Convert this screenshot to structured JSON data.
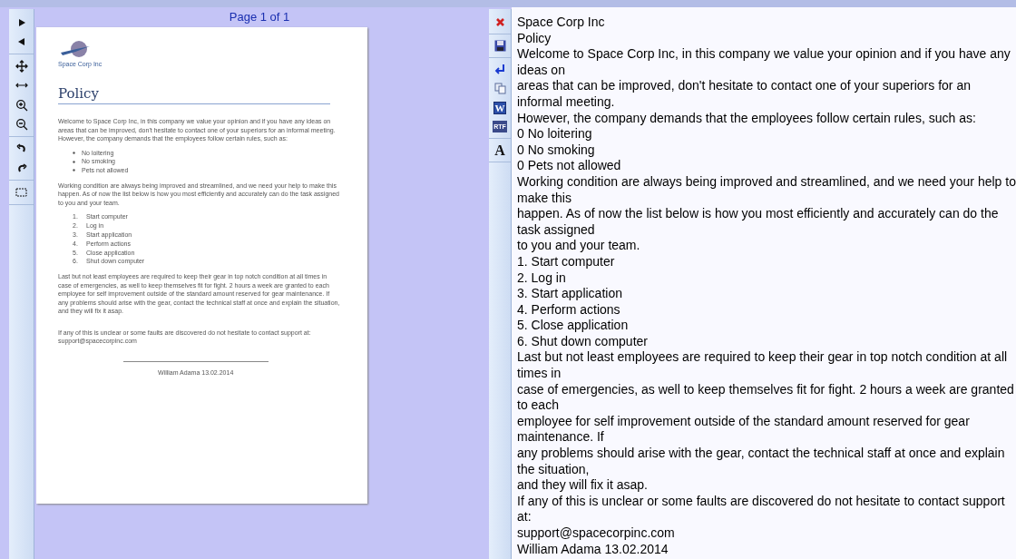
{
  "left_toolbar": {
    "groups": [
      [
        {
          "kind": "next"
        },
        {
          "kind": "prev"
        }
      ],
      [
        {
          "kind": "move"
        },
        {
          "kind": "fit-width"
        },
        {
          "kind": "zoom-in"
        },
        {
          "kind": "zoom-out"
        }
      ],
      [
        {
          "kind": "undo"
        },
        {
          "kind": "redo"
        }
      ],
      [
        {
          "kind": "select"
        }
      ]
    ]
  },
  "preview": {
    "page_label": "Page 1 of 1",
    "document": {
      "logo_text": "Space Corp Inc",
      "heading": "Policy",
      "blocks": [
        {
          "kind": "para",
          "lines": [
            "Welcome to Space Corp Inc, in this company we value your opinion and if you have any ideas on",
            "areas that can be improved, don't hesitate to contact one of your superiors for an informal meeting.",
            "However, the company demands that the employees follow certain rules, such as:"
          ]
        },
        {
          "kind": "bullets",
          "items": [
            "No loitering",
            "No smoking",
            "Pets not allowed"
          ]
        },
        {
          "kind": "para",
          "lines": [
            "Working condition are always being improved and streamlined, and we need your help to make this",
            "happen. As of now the list below is how you most efficiently and accurately can do the task assigned",
            "to you and your team."
          ]
        },
        {
          "kind": "numbered",
          "items": [
            {
              "num": "1.",
              "text": "Start computer"
            },
            {
              "num": "2.",
              "text": "Log  in"
            },
            {
              "num": "3.",
              "text": "Start application"
            },
            {
              "num": "4.",
              "text": "Perform actions"
            },
            {
              "num": "5.",
              "text": "Close application"
            },
            {
              "num": "6.",
              "text": "Shut down computer"
            }
          ]
        },
        {
          "kind": "para",
          "lines": [
            "Last but not least employees are required to keep their gear in top notch condition at all times in",
            "case of emergencies, as well to keep themselves fit for fight.  2 hours a week are granted to each",
            "employee for self improvement outside of the standard amount reserved for gear maintenance. If",
            "any problems should arise with the gear, contact the technical staff at once and explain the situation,",
            "and they will fix it asap."
          ]
        },
        {
          "kind": "para",
          "lines": [
            "If any of this is unclear or some faults are discovered do not hesitate to contact support at:",
            "support@spacecorpinc.com"
          ]
        }
      ],
      "signature": "William Adama 13.02.2014"
    }
  },
  "right_toolbar": {
    "groups": [
      [
        {
          "kind": "close"
        }
      ],
      [
        {
          "kind": "save"
        }
      ],
      [
        {
          "kind": "enter"
        },
        {
          "kind": "copy"
        },
        {
          "kind": "word",
          "glyph": "W"
        },
        {
          "kind": "rtf",
          "glyph": "RTF"
        }
      ],
      [
        {
          "kind": "font",
          "glyph": "A"
        }
      ]
    ]
  },
  "text_view": {
    "lines": [
      "Space Corp Inc",
      "Policy",
      "Welcome to Space Corp Inc, in this company we value your opinion and if you have any ideas on",
      "areas that can be improved, don't hesitate to contact one of your superiors for an informal meeting.",
      "However, the company demands that the employees follow certain rules, such as:",
      "0 No loitering",
      "0 No smoking",
      "0 Pets not allowed",
      "Working condition are always being improved and streamlined, and we need your help to make this",
      "happen. As of now the list below is how you most efficiently and accurately can do the task assigned",
      "to you and your team.",
      "1. Start computer",
      "2. Log in",
      "3. Start application",
      "4. Perform actions",
      "5. Close application",
      "6. Shut down computer",
      "Last but not least employees are required to keep their gear in top notch condition at all times in",
      "case of emergencies, as well to keep themselves fit for fight. 2 hours a week are granted to each",
      "employee for self improvement outside of the standard amount reserved for gear maintenance. If",
      "any problems should arise with the gear, contact the technical staff at once and explain the situation,",
      "and they will fix it asap.",
      "If any of this is unclear or some faults are discovered do not hesitate to contact support at:",
      "support@spacecorpinc.com",
      "William Adama 13.02.2014"
    ]
  }
}
